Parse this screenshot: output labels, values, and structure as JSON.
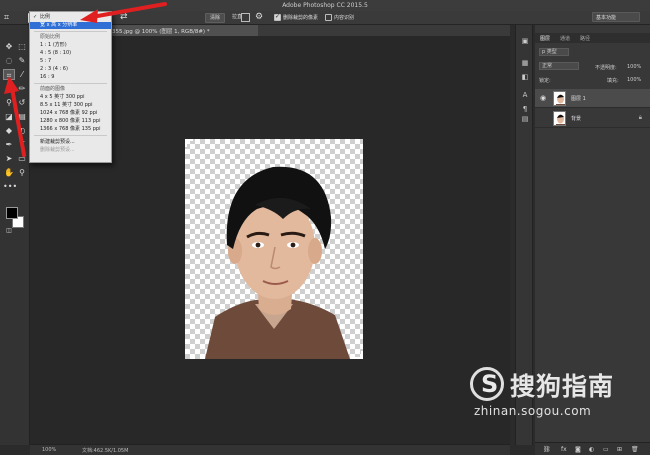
{
  "app": {
    "title": "Adobe Photoshop CC 2015.5",
    "workspace": "基本功能"
  },
  "options": {
    "clear_label": "清除",
    "straighten_label": "拉直",
    "delete_cropped_label": "删除裁剪的像素",
    "content_aware_label": "内容识别"
  },
  "crop_menu": {
    "checked_item": "比例",
    "selected_item": "宽 x 高 x 分辨率",
    "head_original": "原始比例",
    "ratios": [
      "1 : 1 (方形)",
      "4 : 5 (8 : 10)",
      "5 : 7",
      "2 : 3 (4 : 6)",
      "16 : 9"
    ],
    "head_front": "前面的图像",
    "sizes": [
      "4 x 5 英寸 300 ppi",
      "8.5 x 11 英寸 300 ppi",
      "1024 x 768 像素 92 ppi",
      "1280 x 800 像素 113 ppi",
      "1366 x 768 像素 135 ppi"
    ],
    "new_preset": "新建裁剪预设...",
    "delete_preset": "删除裁剪预设..."
  },
  "document": {
    "tab_title": "355.jpg @ 100% (图层 1, RGB/8#) *"
  },
  "status": {
    "zoom": "100%",
    "doc_info": "文档:462.5K/1.05M"
  },
  "layers_panel": {
    "tabs": [
      "图层",
      "通道",
      "路径"
    ],
    "filter": "p 类型",
    "blend_mode": "正常",
    "opacity_label": "不透明度:",
    "opacity_value": "100%",
    "lock_label": "锁定:",
    "fill_label": "填充:",
    "fill_value": "100%",
    "layers": [
      {
        "name": "图层 1"
      },
      {
        "name": "背景"
      }
    ]
  },
  "watermark": {
    "brand": "搜狗指南",
    "url": "zhinan.sogou.com"
  },
  "colors": {
    "arrow": "#e02020",
    "menu_highlight": "#2f6fd6",
    "canvas_bg": "#282828"
  }
}
